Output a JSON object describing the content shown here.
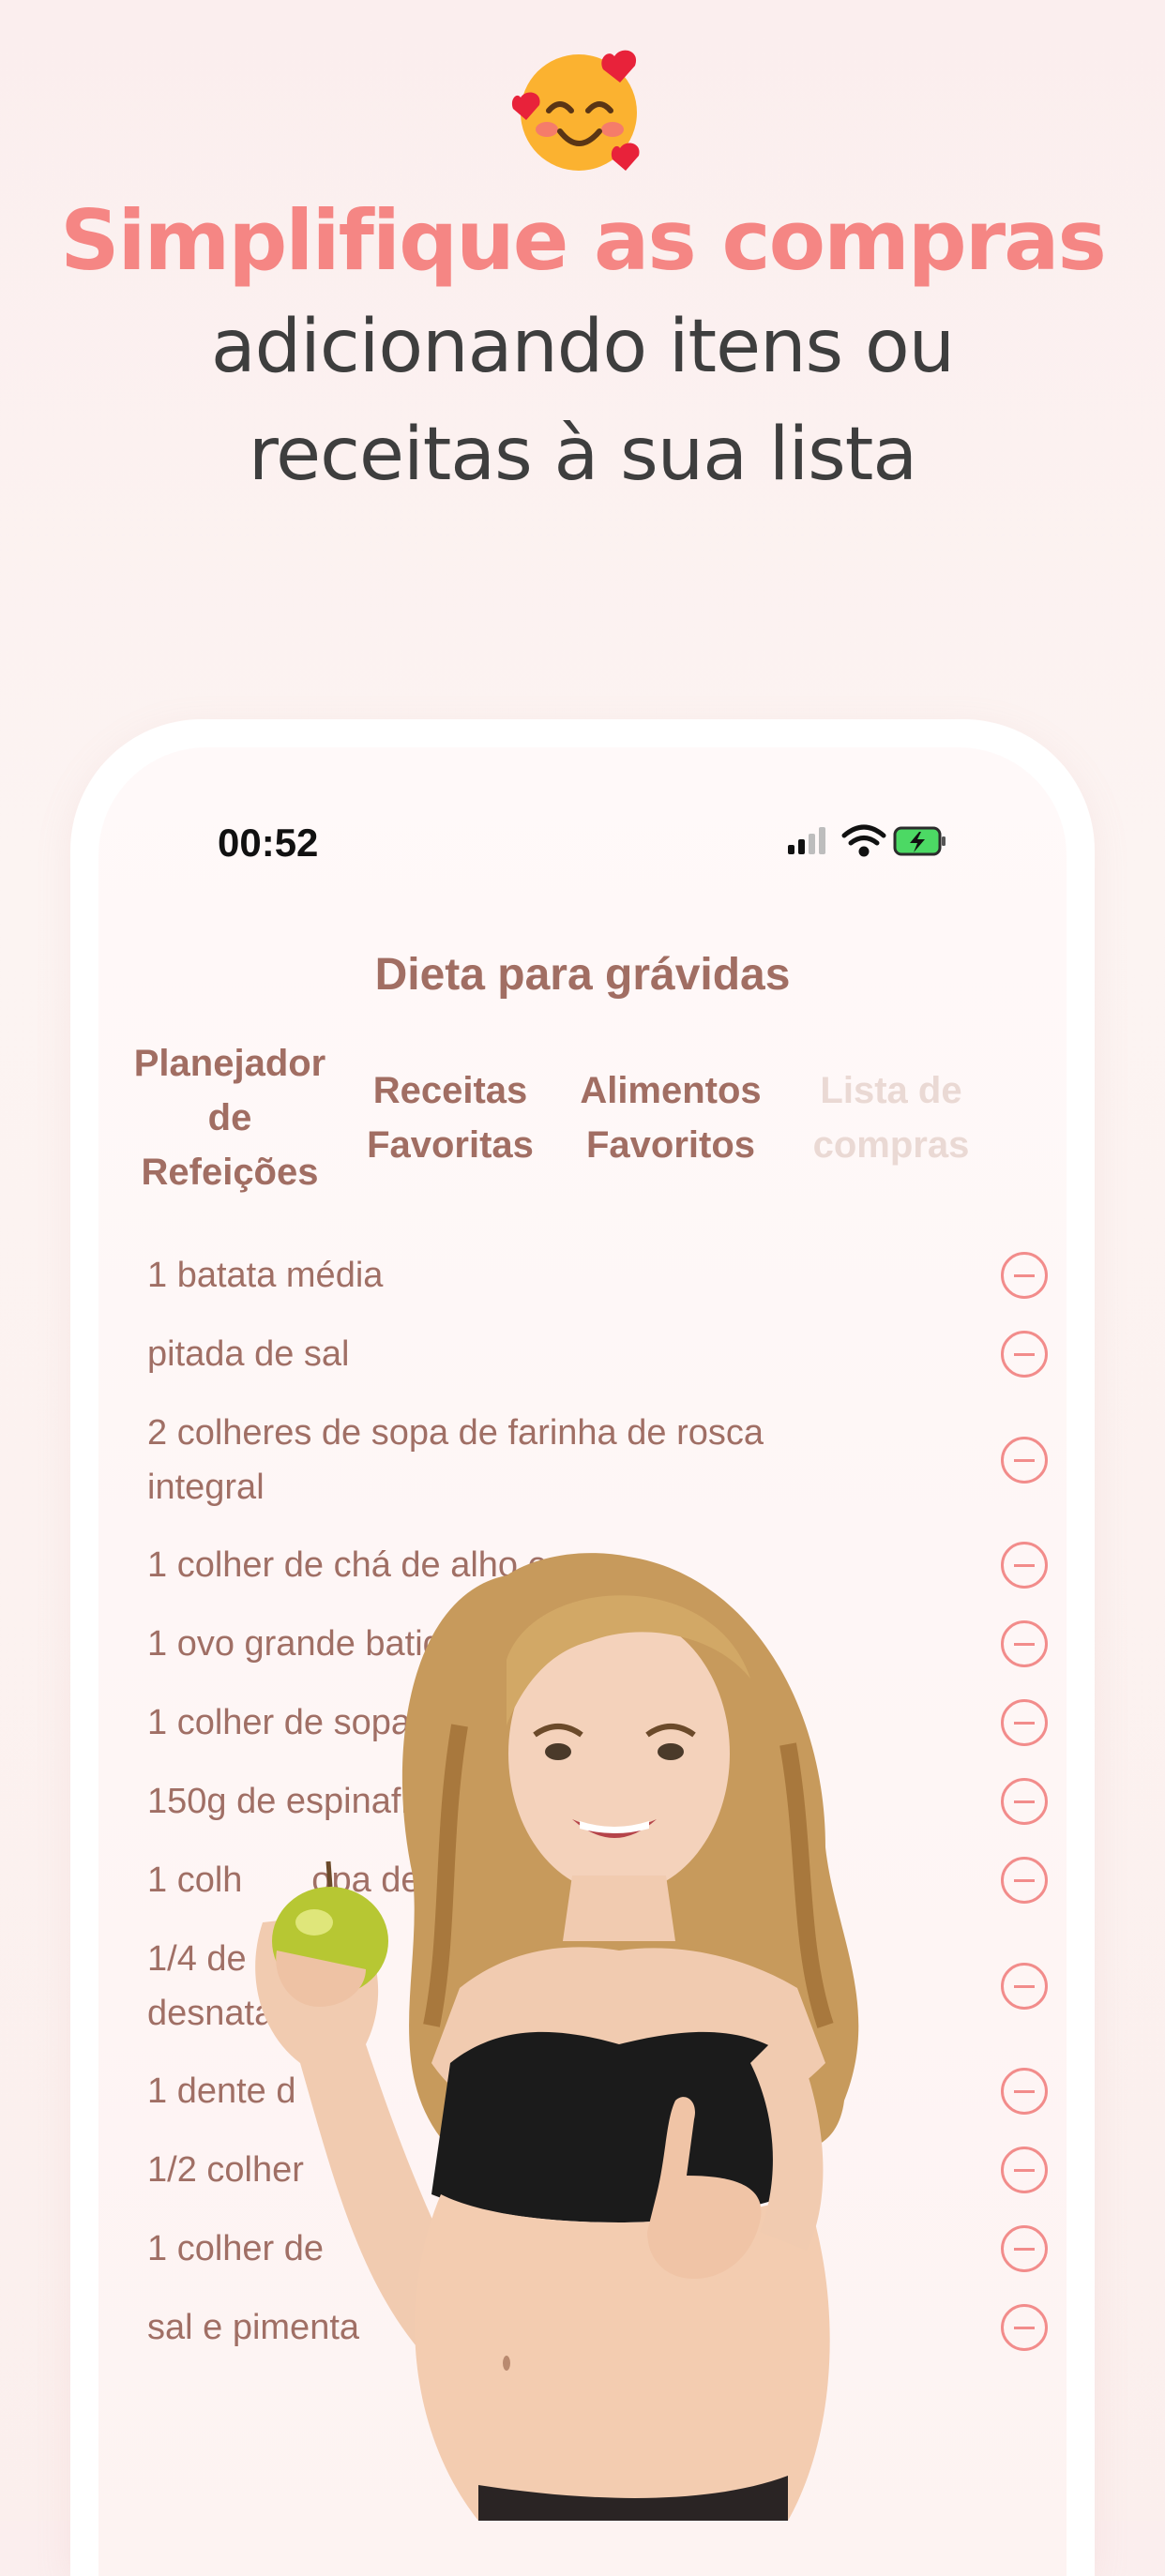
{
  "header": {
    "emoji_icon": "smiling-face-with-hearts",
    "headline": "Simplifique as compras",
    "subline_1": "adicionando itens ou",
    "subline_2": "receitas à sua lista"
  },
  "status_bar": {
    "time": "00:52",
    "icons": [
      "signal-icon",
      "wifi-icon",
      "battery-charging-icon"
    ]
  },
  "app": {
    "title": "Dieta para grávidas",
    "tabs": [
      {
        "label": "Planejador de Refeições",
        "active": false
      },
      {
        "label": "Receitas Favoritas",
        "active": false
      },
      {
        "label": "Alimentos Favoritos",
        "active": false
      },
      {
        "label": "Lista de compras",
        "active": true
      }
    ],
    "shopping_list": [
      "1 batata média",
      "pitada de sal",
      "2 colheres de sopa de farinha de rosca integral",
      "1 colher de chá de alho em",
      "1 ovo grande batido",
      "1 colher de sopa de az",
      "150g de espinafre cor",
      "1 colh       opa de r",
      "1/4 de        de desnata",
      "1 dente d   lh",
      "1/2 colher",
      "1 colher de",
      "sal e pimenta"
    ]
  },
  "colors": {
    "accent": "#f58684",
    "brand_text": "#a16e63",
    "remove_icon": "#f28c8b"
  }
}
